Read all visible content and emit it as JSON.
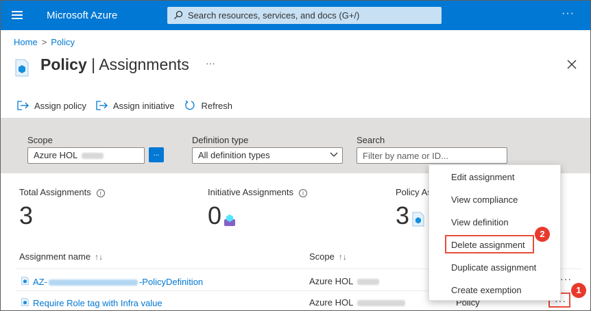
{
  "topbar": {
    "brand": "Microsoft Azure",
    "search_placeholder": "Search resources, services, and docs (G+/)",
    "more": "···"
  },
  "breadcrumb": {
    "home": "Home",
    "policy": "Policy",
    "separator": ">"
  },
  "title": {
    "main": "Policy",
    "separator": " | ",
    "sub": "Assignments",
    "more": "···"
  },
  "toolbar": {
    "assign_policy": "Assign policy",
    "assign_initiative": "Assign initiative",
    "refresh": "Refresh"
  },
  "filters": {
    "scope_label": "Scope",
    "scope_value": "Azure HOL",
    "scope_button": "...",
    "definition_type_label": "Definition type",
    "definition_type_value": "All definition types",
    "search_label": "Search",
    "search_placeholder": "Filter by name or ID..."
  },
  "stats": {
    "total_label": "Total Assignments",
    "total_value": "3",
    "initiative_label": "Initiative Assignments",
    "initiative_value": "0",
    "policy_label": "Policy As",
    "policy_value": "3"
  },
  "table": {
    "col_name": "Assignment name",
    "col_scope": "Scope",
    "sort_glyph": "↑↓",
    "rows": [
      {
        "name_prefix": "AZ-",
        "name_suffix": "-PolicyDefinition",
        "scope": "Azure HOL",
        "type": ""
      },
      {
        "name_prefix": "Require Role tag with Infra value",
        "name_suffix": "",
        "scope": "Azure HOL",
        "type": "Policy"
      }
    ]
  },
  "context_menu": {
    "items": [
      "Edit assignment",
      "View compliance",
      "View definition",
      "Delete assignment",
      "Duplicate assignment",
      "Create exemption"
    ]
  },
  "badges": {
    "one": "1",
    "two": "2"
  },
  "colors": {
    "accent": "#0078d4",
    "highlight": "#e74c3c",
    "filter_bg": "#e1dfdd"
  }
}
